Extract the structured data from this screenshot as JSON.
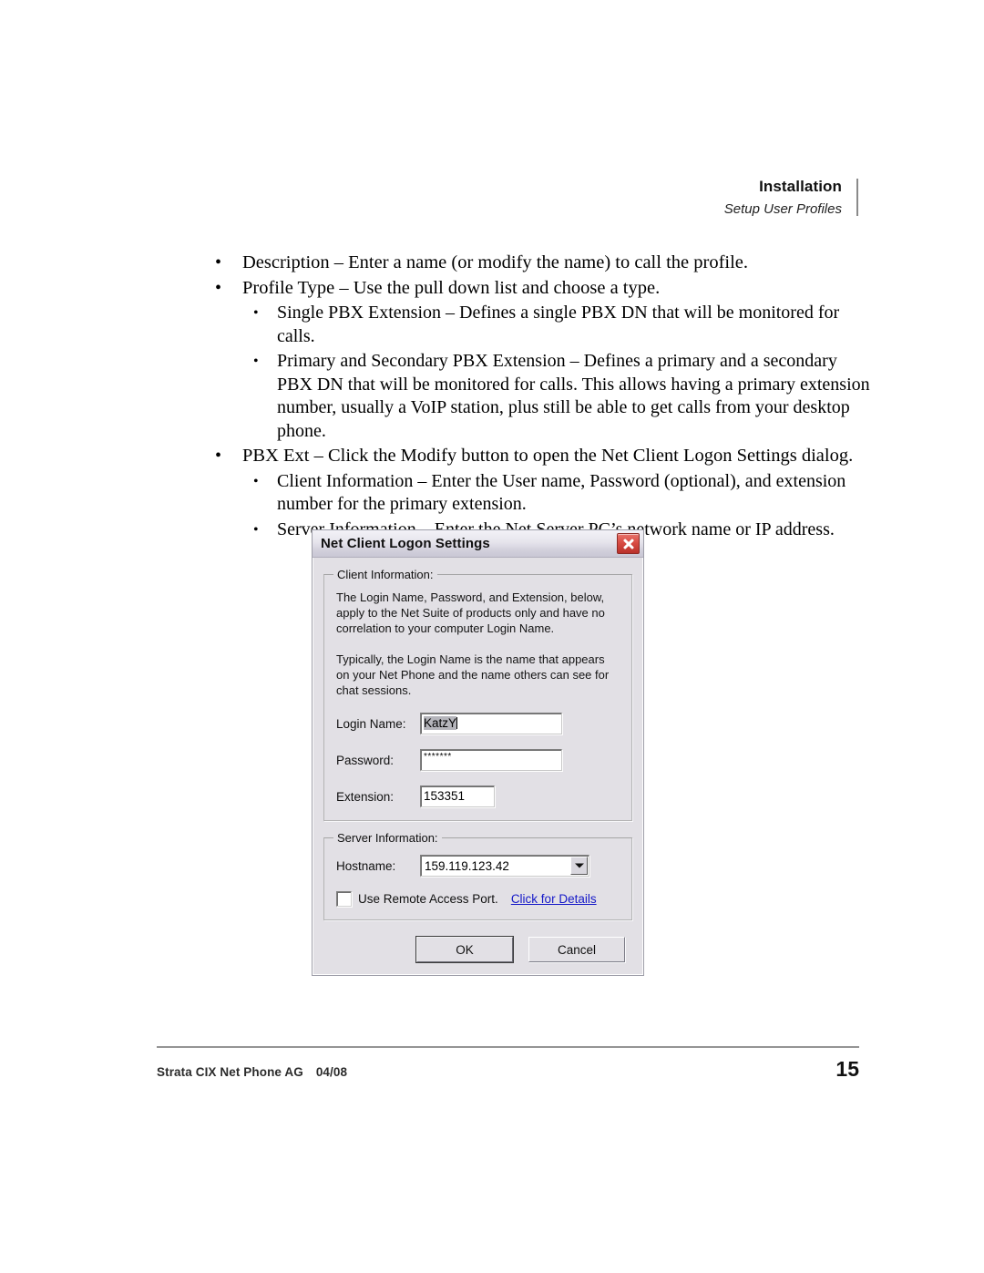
{
  "header": {
    "chapter": "Installation",
    "section": "Setup User Profiles"
  },
  "content": {
    "bullets": [
      {
        "level": 1,
        "text": "Description – Enter a name (or modify the name) to call the profile."
      },
      {
        "level": 1,
        "text": "Profile Type – Use the pull down list and choose a type."
      },
      {
        "level": 2,
        "text": "Single PBX Extension – Defines a single PBX DN that will be monitored for calls."
      },
      {
        "level": 2,
        "text": "Primary and Secondary PBX Extension – Defines a primary and a secondary PBX DN that will be monitored for calls. This allows having a primary extension number, usually a VoIP station, plus still be able to get calls from your desktop phone."
      },
      {
        "level": 1,
        "text": "PBX Ext – Click the Modify button to open the Net Client Logon Settings dialog."
      },
      {
        "level": 2,
        "text": "Client Information – Enter the User name, Password (optional), and extension number for the primary extension."
      },
      {
        "level": 2,
        "text": "Server Information – Enter the Net Server PC’s network name or IP address."
      }
    ],
    "bullet_glyph": "•"
  },
  "dialog": {
    "title": "Net Client Logon Settings",
    "close_icon": "close-icon",
    "client_group": {
      "label": "Client Information:",
      "paragraph1": "The Login Name, Password, and Extension, below, apply to the Net Suite of products only and have no correlation to your computer Login Name.",
      "paragraph2": "Typically, the Login Name is the name that appears on your Net Phone and the name others can see for chat sessions.",
      "fields": [
        {
          "label": "Login Name:",
          "value": "KatzY"
        },
        {
          "label": "Password:",
          "value": "*******"
        },
        {
          "label": "Extension:",
          "value": "153351"
        }
      ]
    },
    "server_group": {
      "label": "Server Information:",
      "hostname_label": "Hostname:",
      "hostname_value": "159.119.123.42",
      "dropdown_icon": "chevron-down-icon",
      "remote_access_label": "Use Remote Access Port.",
      "remote_access_checked": false,
      "details_link": "Click for Details"
    },
    "buttons": {
      "ok": "OK",
      "cancel": "Cancel"
    },
    "colors": {
      "face": "#e2e0e5",
      "close_red": "#d74a42",
      "link_blue": "#1418c8",
      "selection_gray": "#b5b5bb"
    }
  },
  "footer": {
    "doc_title": "Strata CIX Net Phone AG",
    "date": "04/08",
    "page_number": "15"
  }
}
